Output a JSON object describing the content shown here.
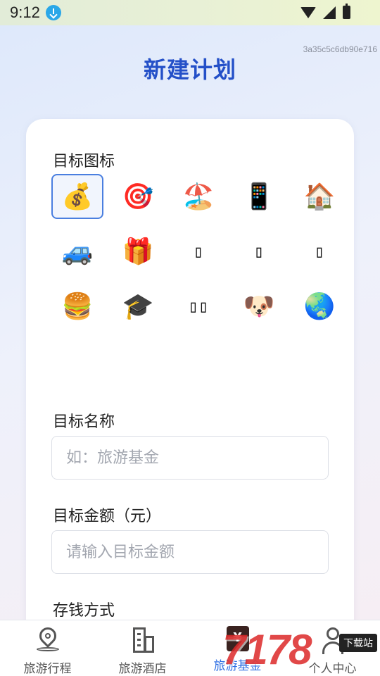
{
  "status": {
    "time": "9:12"
  },
  "hash": "3a35c5c6db90e716",
  "title": "新建计划",
  "form": {
    "icon_label": "目标图标",
    "icons": [
      {
        "glyph": "💰",
        "name": "money-bag-icon",
        "selected": true
      },
      {
        "glyph": "🎯",
        "name": "target-icon",
        "selected": false
      },
      {
        "glyph": "🏖️",
        "name": "beach-umbrella-icon",
        "selected": false
      },
      {
        "glyph": "📱",
        "name": "phone-icon",
        "selected": false
      },
      {
        "glyph": "🏠",
        "name": "house-icon",
        "selected": false
      },
      {
        "glyph": "🚙",
        "name": "car-icon",
        "selected": false
      },
      {
        "glyph": "🎁",
        "name": "gift-icon",
        "selected": false
      },
      {
        "glyph": "▯",
        "name": "missing-glyph-icon",
        "selected": false
      },
      {
        "glyph": "▯",
        "name": "missing-glyph-icon",
        "selected": false
      },
      {
        "glyph": "▯",
        "name": "missing-glyph-icon",
        "selected": false
      },
      {
        "glyph": "🍔",
        "name": "burger-icon",
        "selected": false
      },
      {
        "glyph": "🎓",
        "name": "graduation-cap-icon",
        "selected": false
      },
      {
        "glyph": "▯▯",
        "name": "missing-glyph-icon",
        "selected": false
      },
      {
        "glyph": "🐶",
        "name": "dog-icon",
        "selected": false
      },
      {
        "glyph": "🌏",
        "name": "globe-icon",
        "selected": false
      }
    ],
    "name_label": "目标名称",
    "name_placeholder": "如：旅游基金",
    "amount_label": "目标金额（元）",
    "amount_placeholder": "请输入目标金额",
    "method_label": "存钱方式"
  },
  "nav": {
    "items": [
      {
        "label": "旅游行程",
        "icon": "location-pin-icon"
      },
      {
        "label": "旅游酒店",
        "icon": "building-icon"
      },
      {
        "label": "旅游基金",
        "icon": "wallet-icon",
        "active": true
      },
      {
        "label": "个人中心",
        "icon": "person-icon"
      }
    ],
    "wallet_glyph": "¥"
  },
  "watermark": {
    "text": "7178",
    "badge": "下载站"
  },
  "accent": "#2f6fe3",
  "title_color": "#2450c8"
}
